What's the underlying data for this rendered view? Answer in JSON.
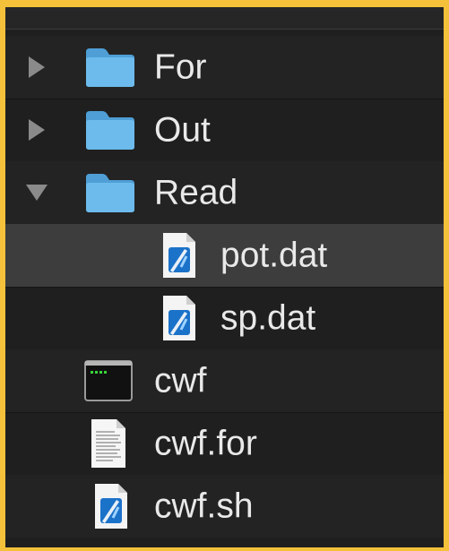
{
  "file_list": {
    "items": [
      {
        "name": "For",
        "kind": "folder",
        "disclosure": "collapsed"
      },
      {
        "name": "Out",
        "kind": "folder",
        "disclosure": "collapsed"
      },
      {
        "name": "Read",
        "kind": "folder",
        "disclosure": "expanded"
      },
      {
        "name": "pot.dat",
        "kind": "xcode-document",
        "selected": true
      },
      {
        "name": "sp.dat",
        "kind": "xcode-document"
      },
      {
        "name": "cwf",
        "kind": "unix-executable"
      },
      {
        "name": "cwf.for",
        "kind": "text-document"
      },
      {
        "name": "cwf.sh",
        "kind": "xcode-document"
      }
    ]
  },
  "colors": {
    "background_frame": "#f5c13a",
    "list_background": "#1f1f1f",
    "selected_row": "#3d3d3d",
    "folder_blue": "#64b5e8",
    "text": "#e9e9e9"
  }
}
